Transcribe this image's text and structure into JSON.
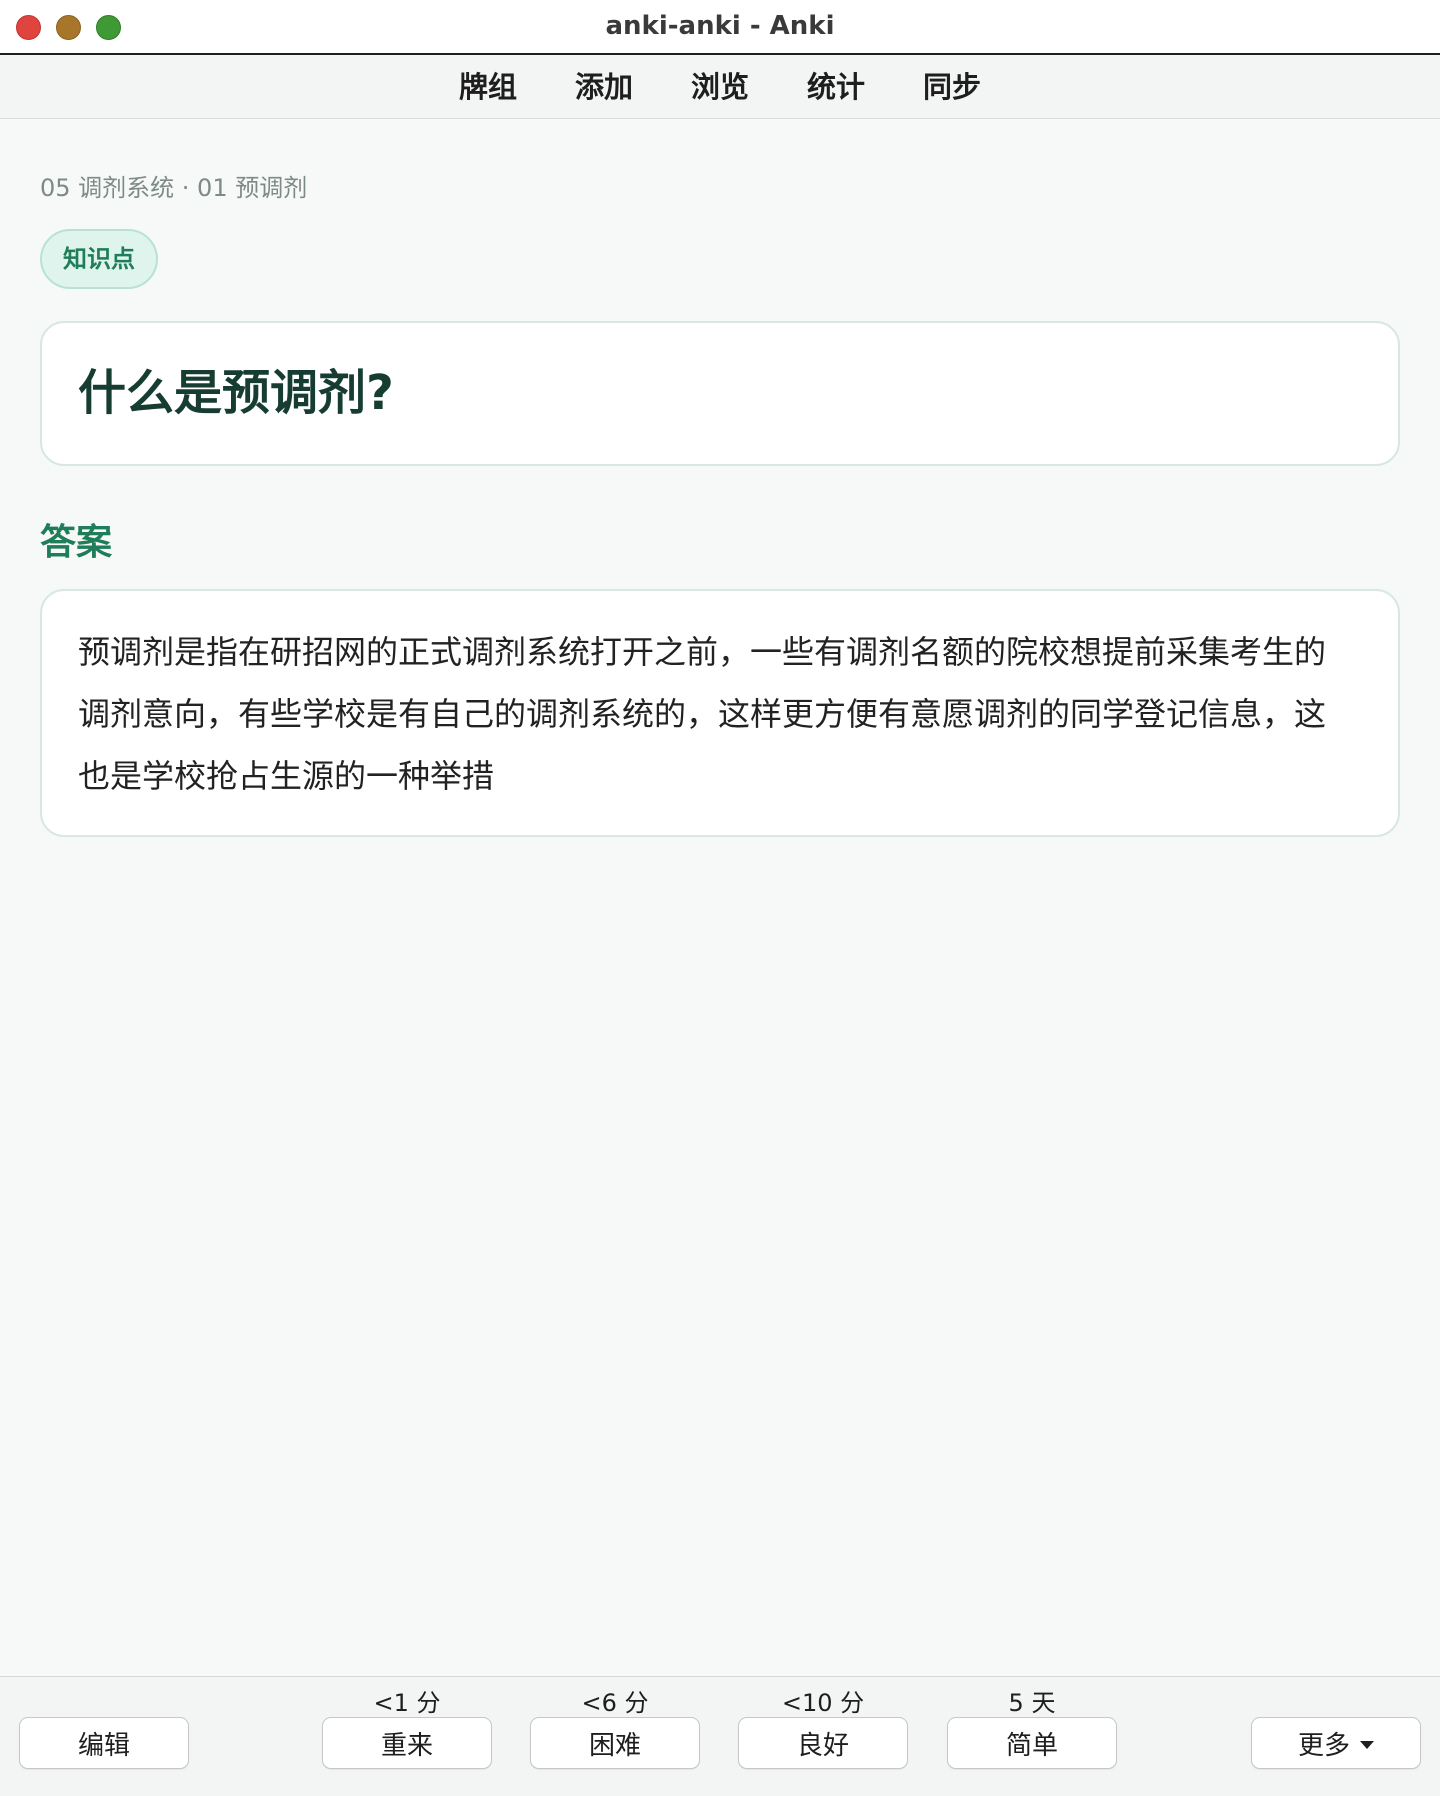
{
  "window": {
    "title": "anki-anki - Anki"
  },
  "nav": {
    "items": [
      {
        "label": "牌组"
      },
      {
        "label": "添加"
      },
      {
        "label": "浏览"
      },
      {
        "label": "统计"
      },
      {
        "label": "同步"
      }
    ]
  },
  "card": {
    "breadcrumb": "05 调剂系统 · 01 预调剂",
    "tag": "知识点",
    "question": "什么是预调剂?",
    "answer_heading": "答案",
    "answer": "预调剂是指在研招网的正式调剂系统打开之前，一些有调剂名额的院校想提前采集考生的调剂意向，有些学校是有自己的调剂系统的，这样更方便有意愿调剂的同学登记信息，这也是学校抢占生源的一种举措"
  },
  "bottom": {
    "edit_label": "编辑",
    "more_label": "更多",
    "answers": [
      {
        "label": "重来",
        "interval": "<1 分"
      },
      {
        "label": "困难",
        "interval": "<6 分"
      },
      {
        "label": "良好",
        "interval": "<10 分"
      },
      {
        "label": "简单",
        "interval": "5 天"
      }
    ]
  },
  "colors": {
    "accent": "#1f7d59",
    "tag_background": "#e0f4ee",
    "close": "#e0443e",
    "minimize": "#a8762a",
    "zoom": "#3f9a36"
  }
}
